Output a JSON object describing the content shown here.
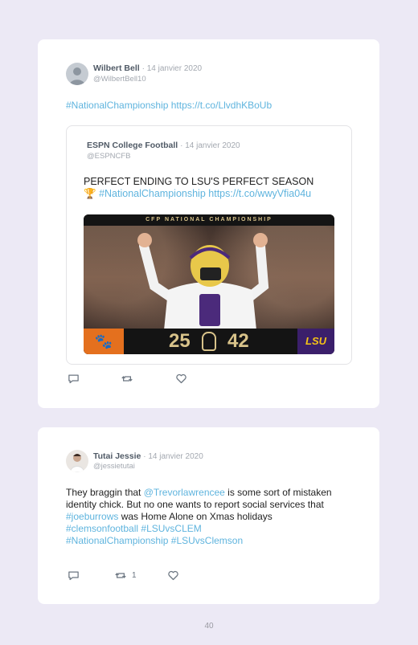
{
  "tweets": [
    {
      "author": "Wilbert Bell",
      "date": "· 14 janvier 2020",
      "handle": "@WilbertBell10",
      "text": "#NationalChampionship https://t.co/LlvdhKBoUb",
      "quote": {
        "author": "ESPN College Football",
        "date": "· 14 janvier 2020",
        "handle": "@ESPNCFB",
        "text_line1": "PERFECT ENDING TO LSU'S PERFECT SEASON",
        "trophy": "🏆",
        "hashtag": "#NationalChampionship",
        "link": "https://t.co/wwyVfia04u",
        "media": {
          "banner": "CFP NATIONAL CHAMPIONSHIP",
          "score_left": "25",
          "score_right": "42",
          "team_right": "LSU"
        }
      },
      "actions": {
        "reply_icon": "reply-icon",
        "retweet_icon": "retweet-icon",
        "like_icon": "heart-icon"
      }
    },
    {
      "author": "Tutai Jessie",
      "date": "· 14 janvier 2020",
      "handle": "@jessietutai",
      "text_parts": {
        "p1": "They braggin that ",
        "mention": "@Trevorlawrencee",
        "p2": " is some sort of mistaken identity chick. But no one wants to report social services that ",
        "tag1": "#joeburrows",
        "p3": " was Home Alone on Xmas holidays ",
        "tag2": "#clemsonfootball",
        "tag3": "#LSUvsCLEM",
        "tag4": "#NationalChampionship",
        "tag5": "#LSUvsClemson"
      },
      "actions": {
        "retweet_count": "1"
      }
    }
  ],
  "page_number": "40",
  "colors": {
    "background": "#ece9f5",
    "link": "#5fb4de",
    "card": "#ffffff"
  }
}
